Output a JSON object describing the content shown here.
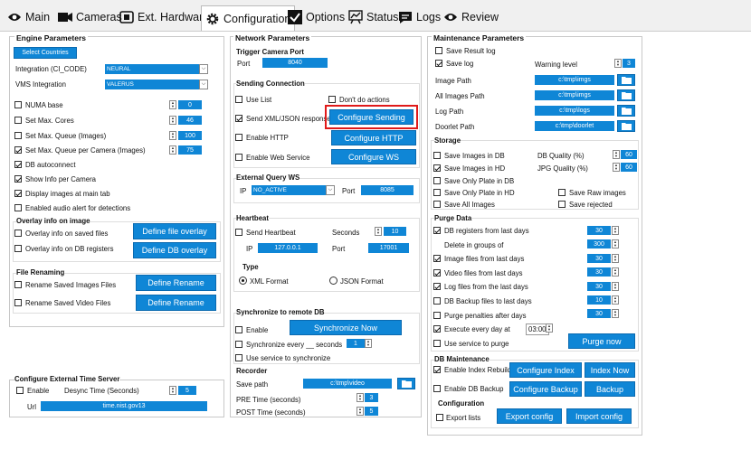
{
  "tabs": [
    {
      "label": "Main"
    },
    {
      "label": "Cameras"
    },
    {
      "label": "Ext. Hardware"
    },
    {
      "label": "Configuration"
    },
    {
      "label": "Options"
    },
    {
      "label": "Status"
    },
    {
      "label": "Logs"
    },
    {
      "label": "Review"
    }
  ],
  "engine": {
    "title": "Engine Parameters",
    "select_countries": "Select Countries",
    "integration_label": "Integration (CI_CODE)",
    "integration_value": "NEURAL",
    "vms_label": "VMS Integration",
    "vms_value": "VALERUS",
    "numa_base": "NUMA base",
    "numa_base_value": "0",
    "max_cores": "Set Max. Cores",
    "max_cores_value": "46",
    "max_queue": "Set Max. Queue (Images)",
    "max_queue_value": "100",
    "max_queue_cam": "Set Max. Queue per Camera (Images)",
    "max_queue_cam_value": "75",
    "db_autoconnect": "DB autoconnect",
    "show_info": "Show Info per Camera",
    "display_images": "Display images at main tab",
    "audio_alert": "Enabled audio alert for detections",
    "overlay_title": "Overlay info on image",
    "overlay_saved": "Overlay info on saved files",
    "overlay_db": "Overlay info on DB registers",
    "define_file_overlay": "Define file overlay",
    "define_db_overlay": "Define DB overlay",
    "renaming_title": "File Renaming",
    "rename_images": "Rename Saved Images Files",
    "rename_videos": "Rename Saved Video Files",
    "define_rename": "Define Rename",
    "time_title": "Configure External Time Server",
    "time_enable": "Enable",
    "desync_label": "Desync Time (Seconds)",
    "desync_value": "5",
    "url_label": "Url",
    "url_value": "time.nist.gov13"
  },
  "network": {
    "title": "Network Parameters",
    "trigger_title": "Trigger Camera Port",
    "port_label": "Port",
    "port_value": "8040",
    "sending_title": "Sending Connection",
    "use_list": "Use List",
    "dont_do": "Don't do actions",
    "send_xml": "Send XML/JSON response",
    "configure_sending": "Configure Sending",
    "enable_http": "Enable HTTP",
    "configure_http": "Configure HTTP",
    "enable_ws": "Enable Web Service",
    "configure_ws": "Configure WS",
    "query_title": "External Query WS",
    "ip_label": "IP",
    "ip_value": "NO_ACTIVE",
    "qport_label": "Port",
    "qport_value": "8085",
    "heartbeat_title": "Heartbeat",
    "send_heartbeat": "Send Heartbeat",
    "seconds_label": "Seconds",
    "seconds_value": "10",
    "hip_label": "IP",
    "hip_value": "127.0.0.1",
    "hport_label": "Port",
    "hport_value": "17001",
    "type_label": "Type",
    "xml_format": "XML Format",
    "json_format": "JSON Format",
    "sync_title": "Synchronize to remote DB",
    "sync_enable": "Enable",
    "sync_now": "Synchronize Now",
    "sync_every": "Synchronize every __ seconds",
    "sync_every_value": "1",
    "use_service_sync": "Use service to synchronize",
    "recorder_title": "Recorder",
    "save_path_label": "Save path",
    "save_path_value": "c:\\tmp\\video",
    "pre_time_label": "PRE Time (seconds)",
    "pre_time_value": "3",
    "post_time_label": "POST Time (seconds)",
    "post_time_value": "5"
  },
  "maintenance": {
    "title": "Maintenance Parameters",
    "save_result_log": "Save Result log",
    "save_log": "Save log",
    "warning_level_label": "Warning level",
    "warning_level_value": "3",
    "image_path_label": "Image Path",
    "image_path_value": "c:\\tmp\\imgs",
    "all_images_path_label": "All Images Path",
    "all_images_path_value": "c:\\tmp\\imgs",
    "log_path_label": "Log Path",
    "log_path_value": "c:\\tmp\\logs",
    "doorlet_path_label": "Doorlet Path",
    "doorlet_path_value": "c:\\tmp\\doorlet",
    "storage_title": "Storage",
    "save_images_db": "Save Images in DB",
    "db_quality_label": "DB Quality (%)",
    "db_quality_value": "60",
    "save_images_hd": "Save Images in HD",
    "jpg_quality_label": "JPG Quality (%)",
    "jpg_quality_value": "60",
    "save_plate_db": "Save Only Plate in DB",
    "save_plate_hd": "Save Only Plate in HD",
    "save_raw": "Save Raw images",
    "save_all": "Save All Images",
    "save_rejected": "Save rejected",
    "purge_title": "Purge Data",
    "db_registers": "DB registers from last days",
    "db_registers_value": "30",
    "delete_groups": "Delete in groups of",
    "delete_groups_value": "300",
    "image_files": "Image files from last days",
    "image_files_value": "30",
    "video_files": "Video files from last days",
    "video_files_value": "30",
    "log_files": "Log files from the last days",
    "log_files_value": "30",
    "db_backup_files": "DB Backup files to last days",
    "db_backup_files_value": "10",
    "purge_penalties": "Purge penalties after days",
    "purge_penalties_value": "30",
    "execute_every": "Execute every day at",
    "execute_time": "03:00",
    "use_service_purge": "Use service to purge",
    "purge_now": "Purge now",
    "dbm_title": "DB Maintenance",
    "enable_index": "Enable Index Rebuild",
    "configure_index": "Configure Index",
    "index_now": "Index Now",
    "enable_backup": "Enable DB Backup",
    "configure_backup": "Configure Backup",
    "backup": "Backup",
    "config_title": "Configuration",
    "export_lists": "Export lists",
    "export_config": "Export config",
    "import_config": "Import config"
  }
}
